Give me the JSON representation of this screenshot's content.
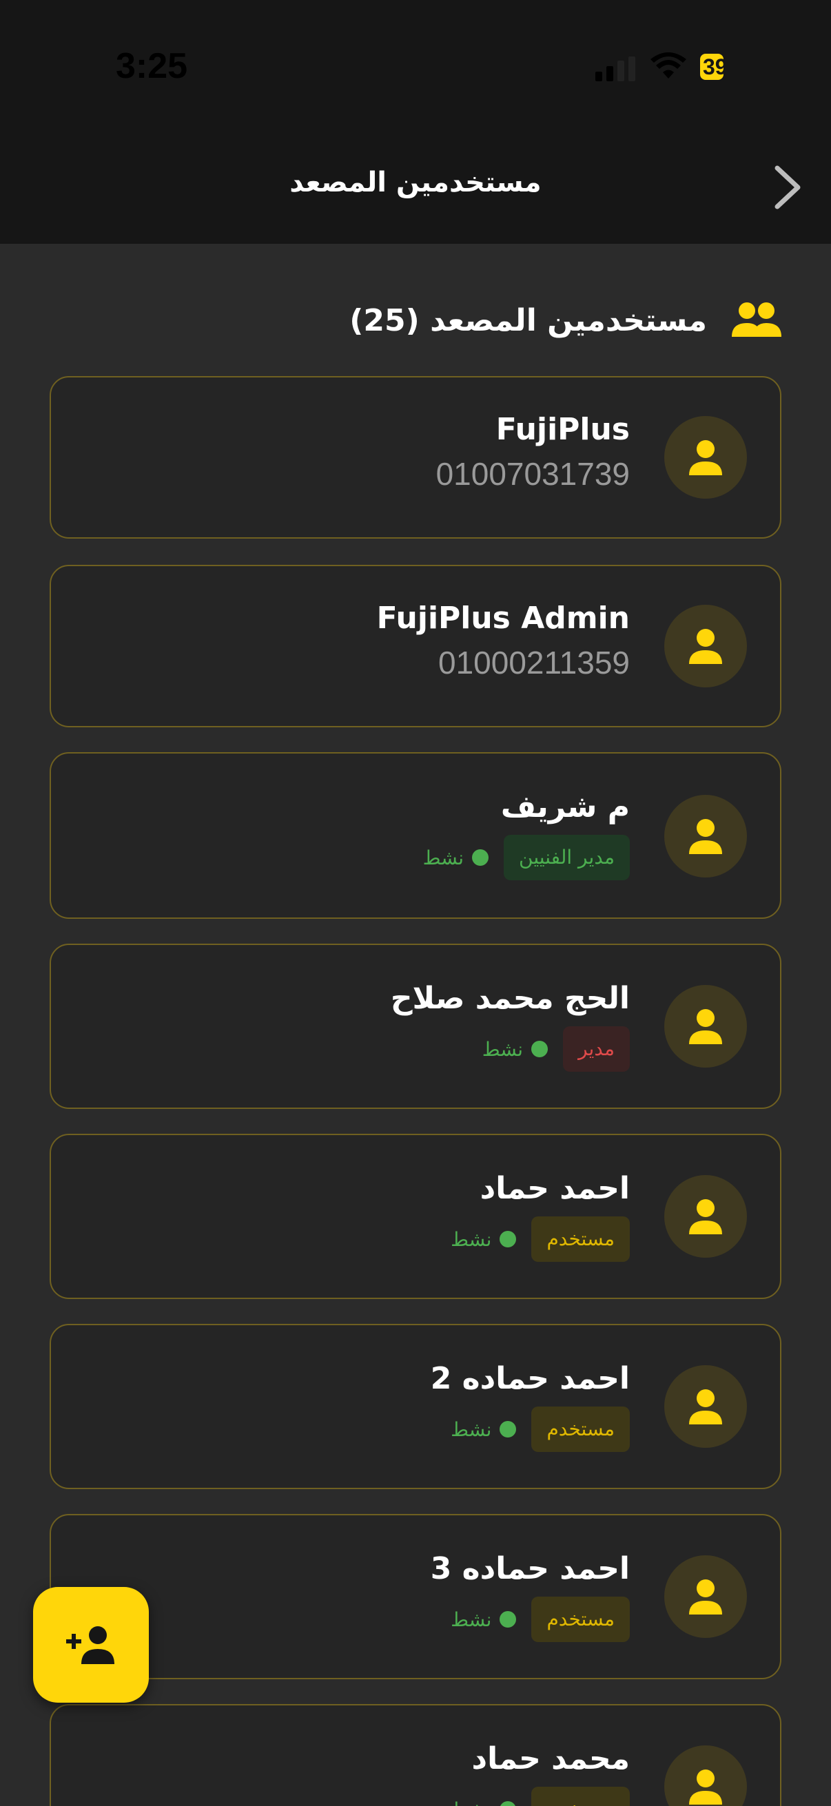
{
  "status_bar": {
    "time": "3:25",
    "battery": "39"
  },
  "header": {
    "title": "مستخدمين المصعد"
  },
  "section": {
    "title": "مستخدمين المصعد (25)"
  },
  "users": [
    {
      "name": "FujiPlus",
      "phone": "01007031739"
    },
    {
      "name": "FujiPlus Admin",
      "phone": "01000211359"
    },
    {
      "name": "م شريف",
      "role": "مدير الفنيين",
      "role_color": "#4caf50",
      "status": "نشط"
    },
    {
      "name": "الحج محمد صلاح",
      "role": "مدير",
      "role_color": "#e04a4a",
      "status": "نشط"
    },
    {
      "name": "احمد حماد",
      "role": "مستخدم",
      "role_color": "#e0b800",
      "status": "نشط"
    },
    {
      "name": "احمد حماده 2",
      "role": "مستخدم",
      "role_color": "#e0b800",
      "status": "نشط"
    },
    {
      "name": "احمد حماده 3",
      "role": "مستخدم",
      "role_color": "#e0b800",
      "status": "نشط"
    },
    {
      "name": "محمد حماد",
      "role": "مستخدم",
      "role_color": "#e0b800",
      "status": "نشط"
    }
  ],
  "icons": {
    "back": "chevron-right-icon",
    "section": "users-group-icon",
    "avatar": "person-icon",
    "fab": "add-user-icon"
  },
  "colors": {
    "accent": "#ffd60a",
    "background": "#2b2b2b",
    "header": "#161616",
    "card_border": "#6f6020",
    "active": "#4caf50"
  }
}
